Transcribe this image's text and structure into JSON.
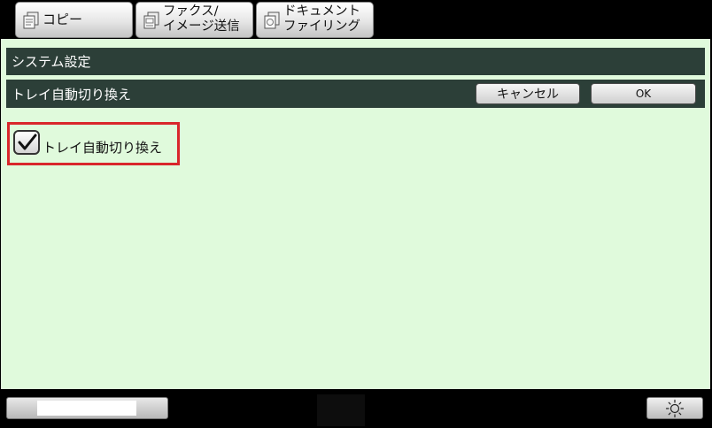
{
  "tabs": {
    "copy": {
      "label": "コピー",
      "icon": "copy-icon"
    },
    "fax": {
      "line1": "ファクス/",
      "line2": "イメージ送信",
      "icon": "fax-icon"
    },
    "filing": {
      "line1": "ドキュメント",
      "line2": "ファイリング",
      "icon": "filing-icon"
    }
  },
  "header": {
    "title": "システム設定"
  },
  "subheader": {
    "title": "トレイ自動切り換え",
    "cancel_label": "キャンセル",
    "ok_label": "OK"
  },
  "option": {
    "label": "トレイ自動切り換え",
    "checked": true
  },
  "footer": {
    "brightness_icon": "brightness-icon"
  },
  "colors": {
    "panel_bg": "#e0fadc",
    "bar_bg": "#2c3f38",
    "highlight": "#d9262b"
  }
}
